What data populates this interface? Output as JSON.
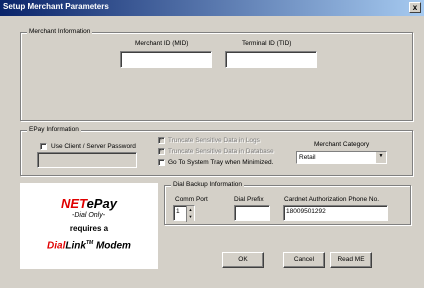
{
  "window": {
    "title": "Setup Merchant Parameters",
    "close": "x"
  },
  "merchant_info": {
    "title": "Merchant Information",
    "mid_label": "Merchant ID (MID)",
    "tid_label": "Terminal ID (TID)",
    "mid_value": "",
    "tid_value": ""
  },
  "epay_info": {
    "title": "EPay Information",
    "use_client_server_password": "Use Client / Server Password",
    "truncate_logs": "Truncate Sensitive Data in Logs",
    "truncate_db": "Truncate Sensitive Data in Database",
    "go_to_tray": "Go To System Tray when Minimized.",
    "merchant_category_label": "Merchant Category",
    "merchant_category_value": "Retail"
  },
  "logo": {
    "brand_a": "NET",
    "brand_b": "ePay",
    "dial_only": "-Dial Only-",
    "requires": "requires a",
    "dial": "Dial",
    "link": "Link",
    "tm": "TM",
    "modem": " Modem",
    "colors": {
      "red": "#e00000",
      "black": "#000000"
    }
  },
  "dial_backup": {
    "title": "Dial Backup Information",
    "comm_port_label": "Comm Port",
    "comm_port_value": "1",
    "dial_prefix_label": "Dial Prefix",
    "dial_prefix_value": "",
    "phone_label": "Cardnet Authorization Phone No.",
    "phone_value": "18009501292"
  },
  "buttons": {
    "ok": "OK",
    "cancel": "Cancel",
    "readme": "Read ME"
  }
}
